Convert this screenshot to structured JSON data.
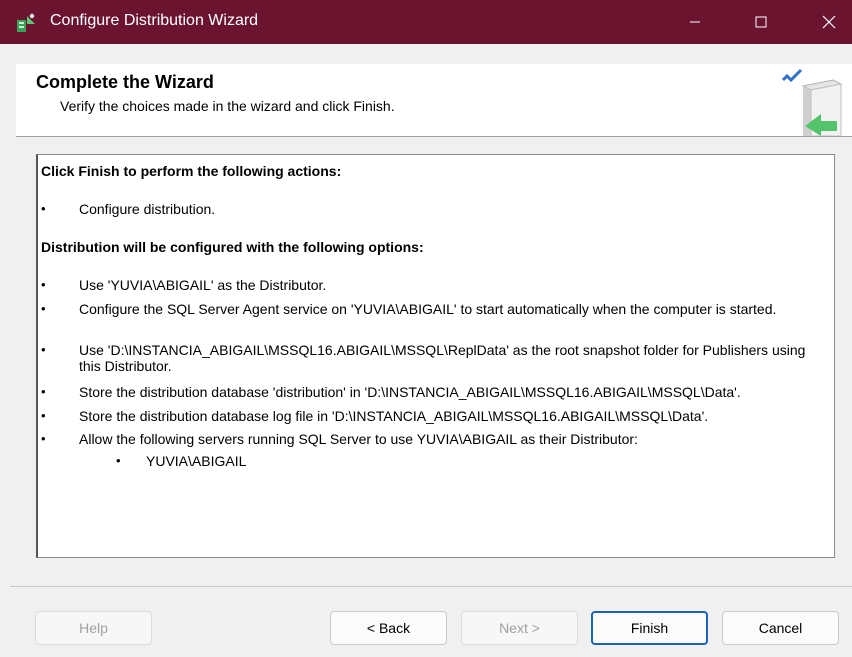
{
  "window": {
    "title": "Configure Distribution Wizard"
  },
  "header": {
    "title": "Complete the Wizard",
    "subtitle": "Verify the choices made in the wizard and click Finish."
  },
  "content": {
    "actions_heading": "Click Finish to perform the following actions:",
    "actions": [
      "Configure distribution."
    ],
    "options_heading": "Distribution will be configured with the following options:",
    "options": [
      "Use 'YUVIA\\ABIGAIL' as the Distributor.",
      "Configure the SQL Server Agent service on 'YUVIA\\ABIGAIL' to start automatically when the computer is started.",
      "Use 'D:\\INSTANCIA_ABIGAIL\\MSSQL16.ABIGAIL\\MSSQL\\ReplData' as the root snapshot folder for Publishers using this Distributor.",
      "Store the distribution database 'distribution' in 'D:\\INSTANCIA_ABIGAIL\\MSSQL16.ABIGAIL\\MSSQL\\Data'.",
      "Store the distribution database log file in 'D:\\INSTANCIA_ABIGAIL\\MSSQL16.ABIGAIL\\MSSQL\\Data'.",
      "Allow the following servers running SQL Server to use YUVIA\\ABIGAIL as their Distributor:"
    ],
    "servers": [
      "YUVIA\\ABIGAIL"
    ],
    "bullet": "•"
  },
  "buttons": {
    "help": "Help",
    "back": "< Back",
    "next": "Next >",
    "finish": "Finish",
    "cancel": "Cancel"
  },
  "colors": {
    "titlebar": "#6b1430",
    "default_button_border": "#1b63b8"
  },
  "icons": {
    "app": "wizard-app-icon",
    "header": "server-check-icon"
  }
}
